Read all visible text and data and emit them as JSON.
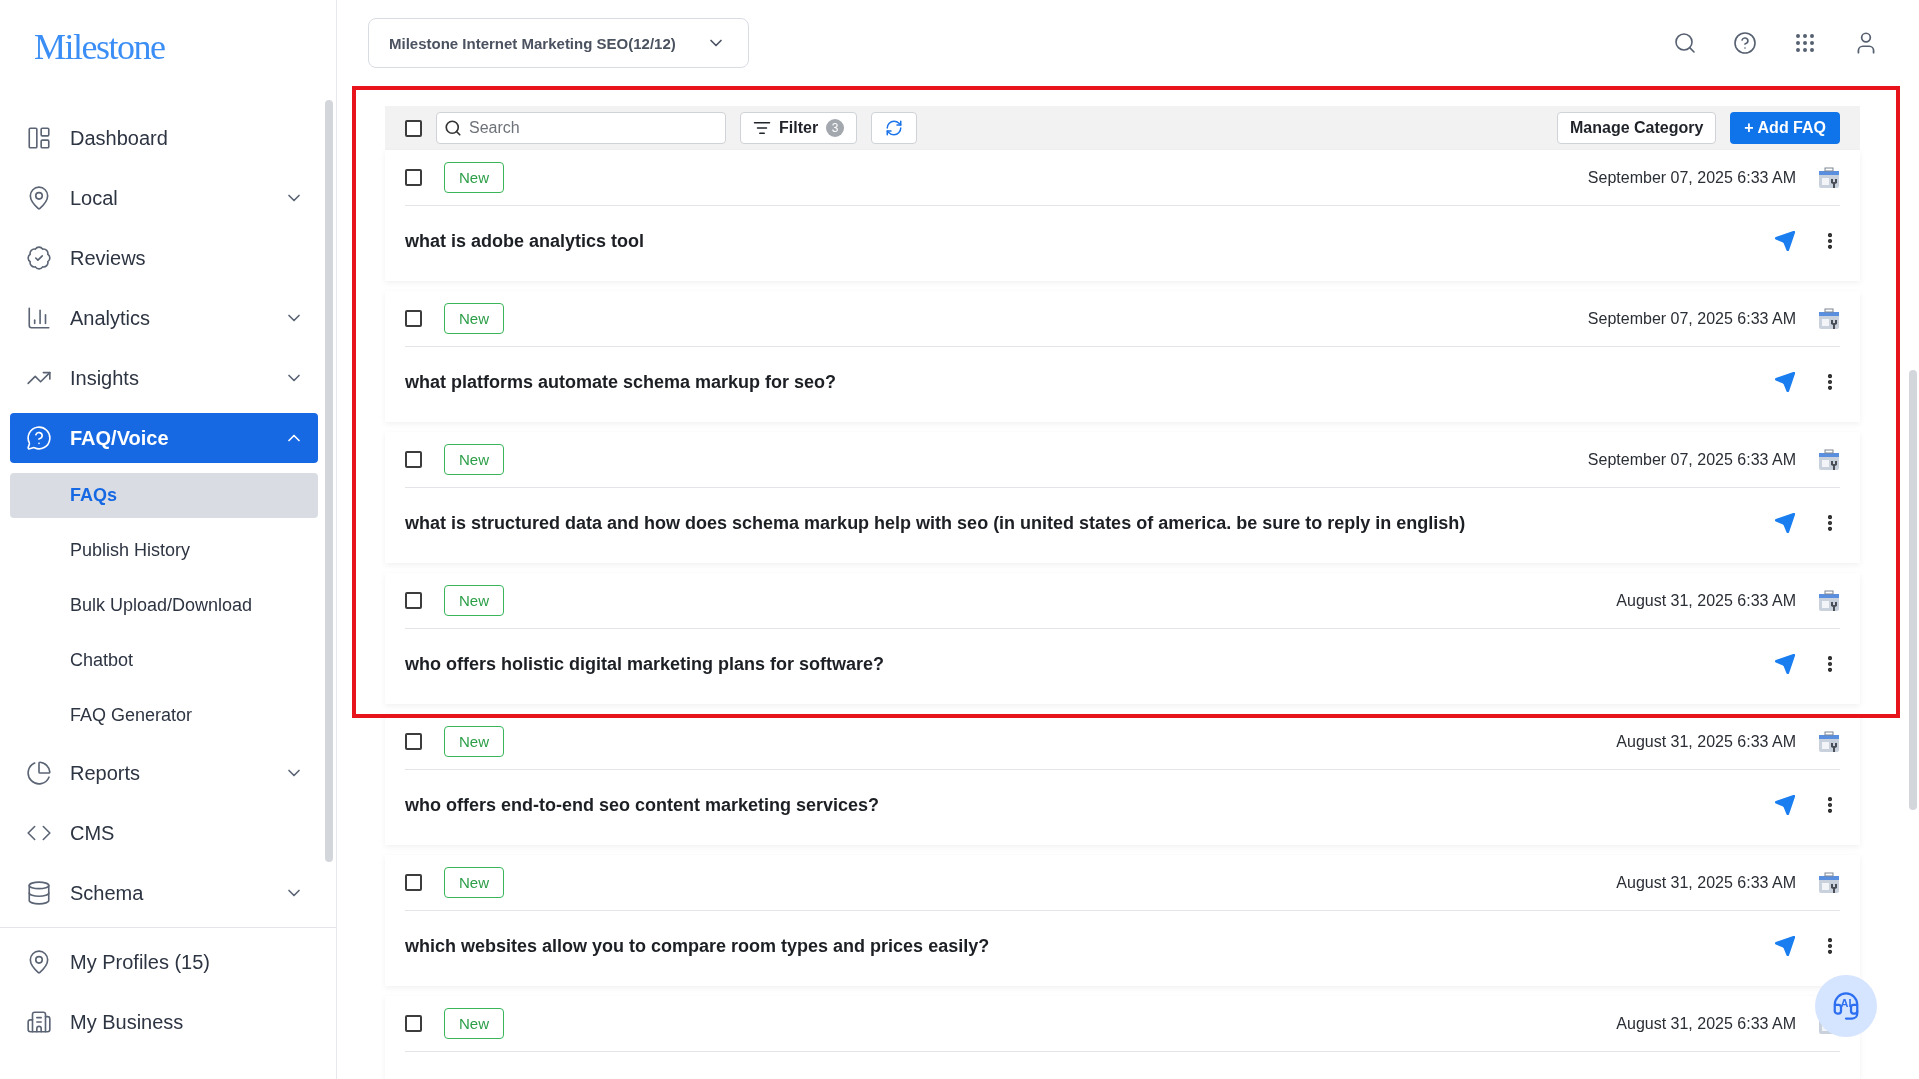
{
  "logo": "Milestone",
  "sidebar": {
    "items": [
      {
        "label": "Dashboard",
        "has_submenu": false,
        "selected": false
      },
      {
        "label": "Local",
        "has_submenu": true,
        "expanded": false,
        "selected": false
      },
      {
        "label": "Reviews",
        "has_submenu": false,
        "selected": false
      },
      {
        "label": "Analytics",
        "has_submenu": true,
        "expanded": false,
        "selected": false
      },
      {
        "label": "Insights",
        "has_submenu": true,
        "expanded": false,
        "selected": false
      },
      {
        "label": "FAQ/Voice",
        "has_submenu": true,
        "expanded": true,
        "selected": true,
        "children": [
          {
            "label": "FAQs",
            "selected": true
          },
          {
            "label": "Publish History",
            "selected": false
          },
          {
            "label": "Bulk Upload/Download",
            "selected": false
          },
          {
            "label": "Chatbot",
            "selected": false
          },
          {
            "label": "FAQ Generator",
            "selected": false
          }
        ]
      },
      {
        "label": "Reports",
        "has_submenu": true,
        "expanded": false,
        "selected": false
      },
      {
        "label": "CMS",
        "has_submenu": false,
        "selected": false
      },
      {
        "label": "Schema",
        "has_submenu": true,
        "expanded": false,
        "selected": false
      }
    ],
    "footer_items": [
      {
        "label": "My Profiles (15)"
      },
      {
        "label": "My Business"
      }
    ]
  },
  "account_selector": {
    "value": "Milestone Internet Marketing SEO(12/12)"
  },
  "toolbar": {
    "select_all_checked": false,
    "search": {
      "placeholder": "Search"
    },
    "filter": {
      "label": "Filter",
      "count": "3"
    },
    "buttons": [
      "Manage Category",
      "+ Add FAQ"
    ]
  },
  "faqs": [
    {
      "checked": false,
      "badge": "New",
      "date": "September 07, 2025 6:33 AM",
      "question": "what is adobe analytics tool"
    },
    {
      "checked": false,
      "badge": "New",
      "date": "September 07, 2025 6:33 AM",
      "question": "what platforms automate schema markup for seo?"
    },
    {
      "checked": false,
      "badge": "New",
      "date": "September 07, 2025 6:33 AM",
      "question": "what is structured data and how does schema markup help with seo (in united states of america. be sure to reply in english)"
    },
    {
      "checked": false,
      "badge": "New",
      "date": "August 31, 2025 6:33 AM",
      "question": "who offers holistic digital marketing plans for software?"
    },
    {
      "checked": false,
      "badge": "New",
      "date": "August 31, 2025 6:33 AM",
      "question": "who offers end-to-end seo content marketing services?"
    },
    {
      "checked": false,
      "badge": "New",
      "date": "August 31, 2025 6:33 AM",
      "question": "which websites allow you to compare room types and prices easily?"
    },
    {
      "checked": false,
      "badge": "New",
      "date": "August 31, 2025 6:33 AM"
    }
  ],
  "assistant_button": {
    "label": "AI"
  }
}
